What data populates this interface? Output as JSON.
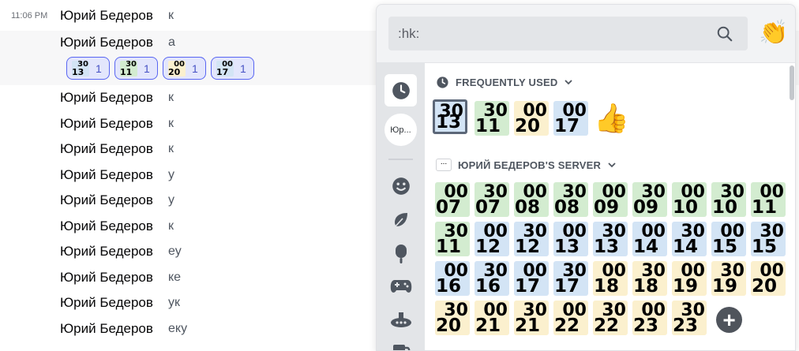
{
  "messages": [
    {
      "time": "11:06 PM",
      "author": "Юрий Бедеров",
      "text": "к"
    },
    {
      "author": "Юрий Бедеров",
      "text": "а"
    },
    {
      "author": "Юрий Бедеров",
      "text": "к"
    },
    {
      "author": "Юрий Бедеров",
      "text": "к"
    },
    {
      "author": "Юрий Бедеров",
      "text": "к"
    },
    {
      "author": "Юрий Бедеров",
      "text": "у"
    },
    {
      "author": "Юрий Бедеров",
      "text": "у"
    },
    {
      "author": "Юрий Бедеров",
      "text": "к"
    },
    {
      "author": "Юрий Бедеров",
      "text": "еу"
    },
    {
      "author": "Юрий Бедеров",
      "text": "ке"
    },
    {
      "author": "Юрий Бедеров",
      "text": "ук"
    },
    {
      "author": "Юрий Бедеров",
      "text": "еку"
    }
  ],
  "reactions": [
    {
      "top": "30",
      "bottom": "13",
      "count": "1",
      "color": "#d3e4f5"
    },
    {
      "top": "30",
      "bottom": "11",
      "count": "1",
      "color": "#d3ecd0"
    },
    {
      "top": "00",
      "bottom": "20",
      "count": "1",
      "color": "#fbf0ce"
    },
    {
      "top": "00",
      "bottom": "17",
      "count": "1",
      "color": "#d3e4f5"
    }
  ],
  "picker": {
    "search_value": ":hk:",
    "search_icon": "search-icon",
    "preview_emoji": "👏",
    "sidebar": {
      "server_label": "Юр...",
      "categories": [
        "clock-icon",
        "smile-icon",
        "leaf-icon",
        "popsicle-icon",
        "gamepad-icon",
        "submarine-icon",
        "mug-icon"
      ]
    },
    "frequently_used_title": "FREQUENTLY USED",
    "frequently_used": [
      {
        "top": "30",
        "bottom": "13"
      },
      {
        "top": "30",
        "bottom": "11"
      },
      {
        "top": "00",
        "bottom": "20"
      },
      {
        "top": "00",
        "bottom": "17"
      }
    ],
    "thumbs_emoji": "👍",
    "server_icon_text": "...",
    "server_title": "ЮРИЙ БЕДЕРОВ'S SERVER",
    "server_emojis": [
      {
        "top": "00",
        "bottom": "07"
      },
      {
        "top": "30",
        "bottom": "07"
      },
      {
        "top": "00",
        "bottom": "08"
      },
      {
        "top": "30",
        "bottom": "08"
      },
      {
        "top": "00",
        "bottom": "09"
      },
      {
        "top": "30",
        "bottom": "09"
      },
      {
        "top": "00",
        "bottom": "10"
      },
      {
        "top": "30",
        "bottom": "10"
      },
      {
        "top": "00",
        "bottom": "11"
      },
      {
        "top": "30",
        "bottom": "11"
      },
      {
        "top": "00",
        "bottom": "12"
      },
      {
        "top": "30",
        "bottom": "12"
      },
      {
        "top": "00",
        "bottom": "13"
      },
      {
        "top": "30",
        "bottom": "13"
      },
      {
        "top": "00",
        "bottom": "14"
      },
      {
        "top": "30",
        "bottom": "14"
      },
      {
        "top": "00",
        "bottom": "15"
      },
      {
        "top": "30",
        "bottom": "15"
      },
      {
        "top": "00",
        "bottom": "16"
      },
      {
        "top": "30",
        "bottom": "16"
      },
      {
        "top": "00",
        "bottom": "17"
      },
      {
        "top": "30",
        "bottom": "17"
      },
      {
        "top": "00",
        "bottom": "18"
      },
      {
        "top": "30",
        "bottom": "18"
      },
      {
        "top": "00",
        "bottom": "19"
      },
      {
        "top": "30",
        "bottom": "19"
      },
      {
        "top": "00",
        "bottom": "20"
      },
      {
        "top": "30",
        "bottom": "20"
      },
      {
        "top": "00",
        "bottom": "21"
      },
      {
        "top": "30",
        "bottom": "21"
      },
      {
        "top": "00",
        "bottom": "22"
      },
      {
        "top": "30",
        "bottom": "22"
      },
      {
        "top": "00",
        "bottom": "23"
      },
      {
        "top": "30",
        "bottom": "23"
      }
    ],
    "add_label": "+"
  },
  "colors": {
    "green": "#d3ecd0",
    "blue": "#d3e4f5",
    "yellow": "#fbf0ce",
    "accent": "#5865f2"
  }
}
